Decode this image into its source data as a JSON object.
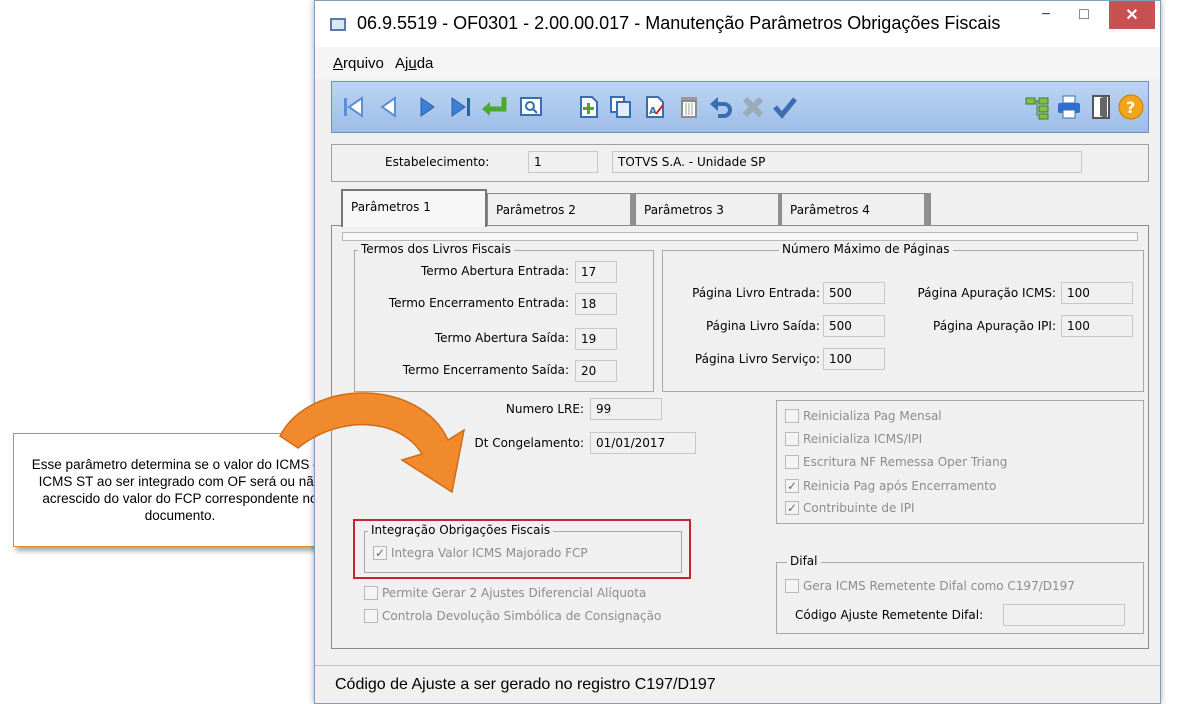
{
  "callout": {
    "text": "Esse parâmetro determina se o valor do ICMS ou ICMS ST ao ser integrado com OF será ou não acrescido do valor do FCP correspondente no documento."
  },
  "window": {
    "title": "06.9.5519 - OF0301 - 2.00.00.017 - Manutenção Parâmetros Obrigações Fiscais",
    "minimize": "−",
    "maximize": "□",
    "close": "✕"
  },
  "menu": {
    "arquivo_u": "A",
    "arquivo_rest": "rquivo",
    "ajuda_a": "Aj",
    "ajuda_u": "u",
    "ajuda_rest": "da"
  },
  "toolbar": {
    "icons": [
      "first-record-icon",
      "previous-record-icon",
      "next-record-icon",
      "last-record-icon",
      "goto-icon",
      "search-icon",
      "add-icon",
      "copy-icon",
      "edit-icon",
      "delete-icon",
      "undo-icon",
      "cancel-icon",
      "confirm-icon",
      "structure-icon",
      "print-icon",
      "exit-icon",
      "help-icon"
    ],
    "help_label": "?"
  },
  "estab": {
    "label": "Estabelecimento:",
    "code": "1",
    "name": "TOTVS S.A. - Unidade SP"
  },
  "tabs": [
    "Parâmetros 1",
    "Parâmetros 2",
    "Parâmetros 3",
    "Parâmetros 4"
  ],
  "termos": {
    "title": "Termos dos Livros Fiscais",
    "abertura_entrada_label": "Termo Abertura Entrada:",
    "abertura_entrada": "17",
    "encerramento_entrada_label": "Termo Encerramento Entrada:",
    "encerramento_entrada": "18",
    "abertura_saida_label": "Termo Abertura Saída:",
    "abertura_saida": "19",
    "encerramento_saida_label": "Termo Encerramento Saída:",
    "encerramento_saida": "20"
  },
  "paginas": {
    "title": "Número Máximo de Páginas",
    "livro_entrada_label": "Página Livro Entrada:",
    "livro_entrada": "500",
    "livro_saida_label": "Página Livro Saída:",
    "livro_saida": "500",
    "livro_servico_label": "Página Livro Serviço:",
    "livro_servico": "100",
    "apuracao_icms_label": "Página  Apuração ICMS:",
    "apuracao_icms": "100",
    "apuracao_ipi_label": "Página  Apuração IPI:",
    "apuracao_ipi": "100"
  },
  "lre": {
    "label": "Numero LRE:",
    "value": "99"
  },
  "congelamento": {
    "label": "Dt Congelamento:",
    "value": "01/01/2017"
  },
  "options": {
    "reinicializa_pag_mensal": "Reinicializa Pag Mensal",
    "reinicializa_icms_ipi": "Reinicializa ICMS/IPI",
    "escritura_nf": "Escritura NF Remessa Oper Triang",
    "reinicia_pag": "Reinicia Pag após Encerramento",
    "contribuinte_ipi": "Contribuinte de IPI",
    "check_mark": "✓"
  },
  "integracao": {
    "title": "Integração Obrigações Fiscais",
    "integra_fcp": "Integra Valor ICMS Majorado FCP"
  },
  "extra": {
    "permite_ajustes": "Permite Gerar 2 Ajustes Diferencial Alíquota",
    "controla_devolucao": "Controla Devolução Simbólica de Consignação"
  },
  "difal": {
    "title": "Difal",
    "gera_icms": "Gera ICMS Remetente Difal como C197/D197",
    "codigo_label": "Código Ajuste Remetente Difal:",
    "codigo_value": ""
  },
  "status": {
    "text": "Código de Ajuste a ser gerado no registro C197/D197"
  }
}
